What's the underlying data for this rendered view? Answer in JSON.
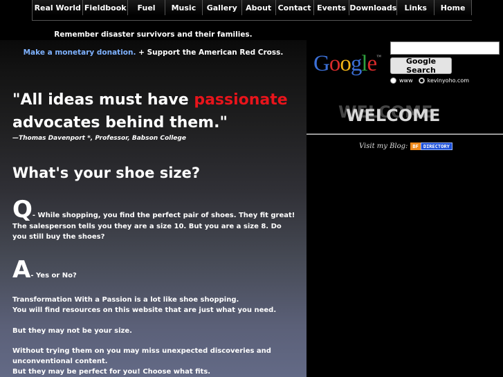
{
  "nav": {
    "items": [
      "Real World",
      "Fieldbook",
      "Fuel",
      "Music",
      "Gallery",
      "About",
      "Contact",
      "Events",
      "Downloads",
      "Links",
      "Home"
    ]
  },
  "tagline": "Remember disaster survivors and their families.",
  "donate": {
    "link": "Make a monetary donation.",
    "text": " + Support the American Red Cross."
  },
  "quote": {
    "before": "\"All ideas must have ",
    "highlight": "passionate",
    "after": " advocates behind them.\"",
    "attribution": "—Thomas Davenport *, Professor, Babson College"
  },
  "shoe": {
    "heading": "What's your shoe size?",
    "q_letter": "Q",
    "q_text": "- While shopping, you find the perfect pair of shoes. They fit great! The salesperson tells you they are a size 10. But you are a size 8. Do you still buy the shoes?",
    "a_letter": "A",
    "a_text": "- Yes or No?"
  },
  "body": {
    "p1": "Transformation With a Passion is a lot like shoe shopping.",
    "p2": "You will find resources on this website that are just what you need.",
    "p3": "But they may not be your size.",
    "p4": "Without trying them on you may miss unexpected discoveries and unconventional content.",
    "p5": "But they may be perfect for you! Choose what fits."
  },
  "search": {
    "logo": "Google",
    "tm": "™",
    "button": "Google Search",
    "opt1": "www",
    "opt2": "kevinyoho.com"
  },
  "welcome": "WELCOME",
  "blog": {
    "label": "Visit my Blog:",
    "badge_a": "BF",
    "badge_b": "DIRECTORY"
  },
  "colors": {
    "accent_red": "#e8141b",
    "link_blue": "#7fb2ff"
  }
}
